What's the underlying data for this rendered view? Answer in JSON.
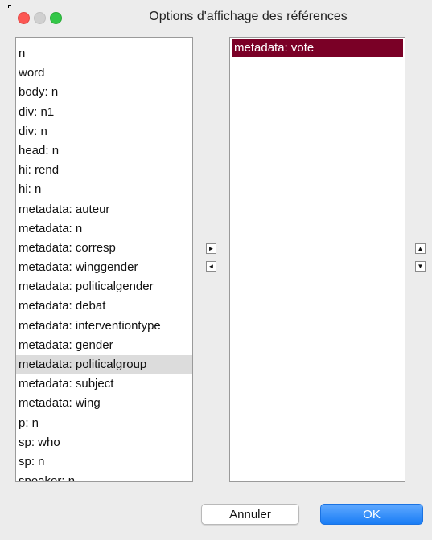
{
  "window": {
    "title": "Options d'affichage des références"
  },
  "available_list": {
    "items": [
      "n",
      "word",
      "body: n",
      "div: n1",
      "div: n",
      "head: n",
      "hi: rend",
      "hi: n",
      "metadata: auteur",
      "metadata: n",
      "metadata: corresp",
      "metadata: winggender",
      "metadata: politicalgender",
      "metadata: debat",
      "metadata: interventiontype",
      "metadata: gender",
      "metadata: politicalgroup",
      "metadata: subject",
      "metadata: wing",
      "p: n",
      "sp: who",
      "sp: n",
      "speaker: n"
    ],
    "highlighted": "metadata: politicalgroup"
  },
  "selected_list": {
    "items": [
      "metadata: vote"
    ]
  },
  "buttons": {
    "add": "►",
    "remove": "◄",
    "move_up": "▲",
    "move_down": "▼",
    "cancel": "Annuler",
    "ok": "OK"
  },
  "colors": {
    "selection": "#7a0026",
    "highlight": "#dcdcdc",
    "ok_button": "#1a7df5"
  }
}
